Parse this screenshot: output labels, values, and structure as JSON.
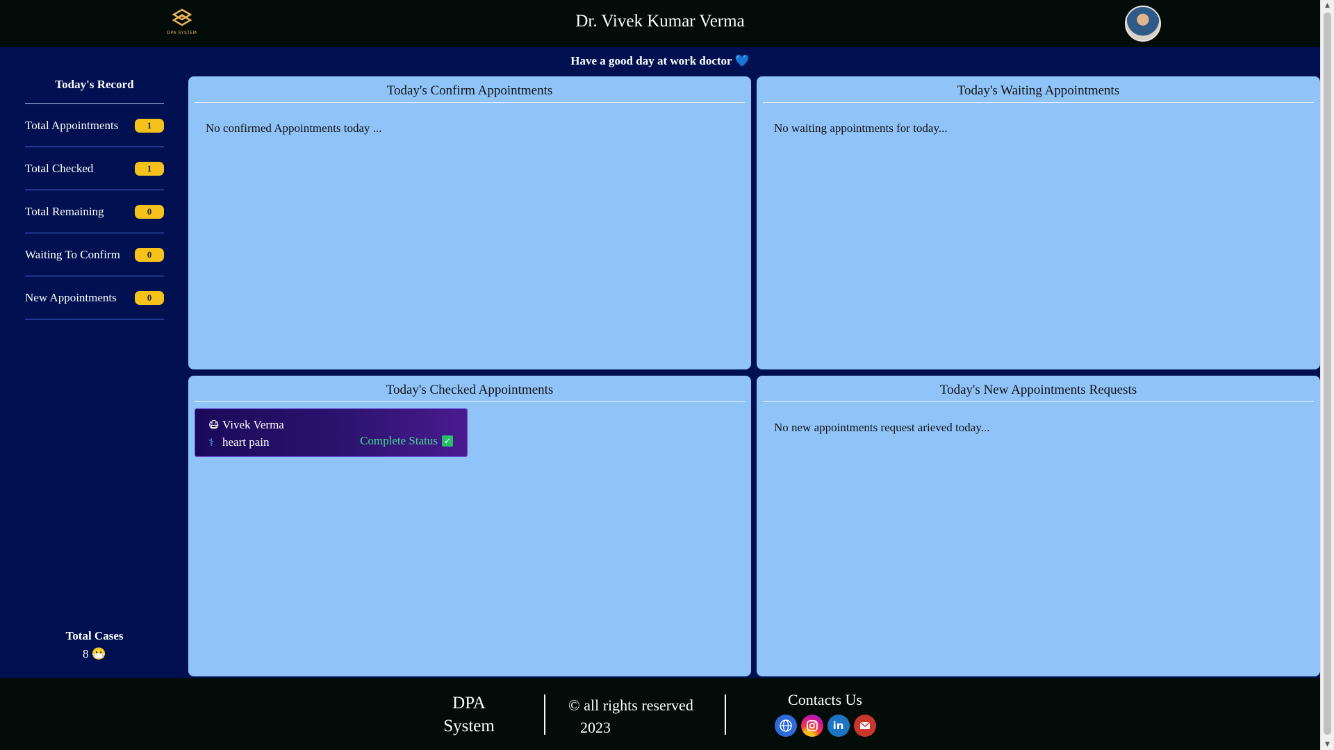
{
  "header": {
    "logo_text": "DPA SYSTEM",
    "doctor_name": "Dr. Vivek Kumar Verma",
    "avatar_icon": "doctor-avatar"
  },
  "greeting": {
    "text": "Have a good day at work doctor",
    "emoji": "💙"
  },
  "sidebar": {
    "title": "Today's Record",
    "stats": [
      {
        "label": "Total Appointments",
        "value": "1"
      },
      {
        "label": "Total Checked",
        "value": "1"
      },
      {
        "label": "Total Remaining",
        "value": "0"
      },
      {
        "label": "Waiting To Confirm",
        "value": "0"
      },
      {
        "label": "New Appointments",
        "value": "0"
      }
    ],
    "total_cases": {
      "label": "Total Cases",
      "value": "8",
      "emoji": "😷"
    }
  },
  "panels": {
    "confirm": {
      "title": "Today's Confirm Appointments",
      "message": "No confirmed Appointments today ..."
    },
    "waiting": {
      "title": "Today's Waiting Appointments",
      "message": "No waiting appointments for today..."
    },
    "checked": {
      "title": "Today's Checked Appointments",
      "appointment": {
        "patient_emoji": "😷",
        "patient_name": "Vivek Verma",
        "problem_emoji": "⚕",
        "problem": "heart pain",
        "status_label": "Complete Status",
        "status_icon": "✓"
      }
    },
    "new": {
      "title": "Today's New Appointments Requests",
      "message": "No new appointments request arieved today..."
    }
  },
  "footer": {
    "brand_line1": "DPA",
    "brand_line2": "System",
    "copyright": "© all rights reserved",
    "year": "2023",
    "contact_title": "Contacts Us",
    "social_icons": [
      "web-icon",
      "instagram-icon",
      "linkedin-icon",
      "mail-icon"
    ],
    "linkedin_text": "in"
  },
  "colors": {
    "page_bg": "#001050",
    "header_bg": "#030c08",
    "panel_bg": "#90c4f9",
    "badge_bg": "#f4c21a",
    "status_green": "#3fdc8f"
  }
}
